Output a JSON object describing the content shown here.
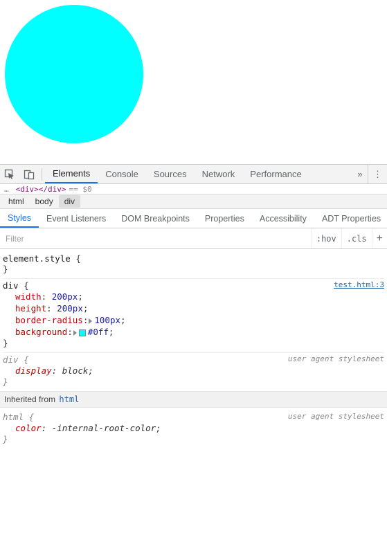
{
  "preview": {
    "shape_color": "#00ffff"
  },
  "toolbar_icons": {
    "select": "select-element-icon",
    "device": "toggle-device-icon",
    "more": "»",
    "kebab": "⋮"
  },
  "main_tabs": [
    {
      "label": "Elements",
      "active": true
    },
    {
      "label": "Console",
      "active": false
    },
    {
      "label": "Sources",
      "active": false
    },
    {
      "label": "Network",
      "active": false
    },
    {
      "label": "Performance",
      "active": false
    }
  ],
  "dom_strip": {
    "ellipsis": "…",
    "text1": "<div>",
    "text2": "</div>",
    "suffix": " == $0"
  },
  "breadcrumbs": [
    {
      "label": "html",
      "selected": false
    },
    {
      "label": "body",
      "selected": false
    },
    {
      "label": "div",
      "selected": true
    }
  ],
  "sub_tabs": [
    {
      "label": "Styles",
      "active": true
    },
    {
      "label": "Event Listeners",
      "active": false
    },
    {
      "label": "DOM Breakpoints",
      "active": false
    },
    {
      "label": "Properties",
      "active": false
    },
    {
      "label": "Accessibility",
      "active": false
    },
    {
      "label": "ADT Properties",
      "active": false
    }
  ],
  "filter": {
    "placeholder": "Filter",
    "hov": ":hov",
    "cls": ".cls",
    "plus": "+"
  },
  "rules": {
    "element_style": {
      "selector": "element.style",
      "open": "{",
      "close": "}"
    },
    "div_main": {
      "selector": "div",
      "open": "{",
      "close": "}",
      "origin_file": "test.html:3",
      "decls": [
        {
          "name": "width",
          "value": "200px",
          "expand": false,
          "swatch": null
        },
        {
          "name": "height",
          "value": "200px",
          "expand": false,
          "swatch": null
        },
        {
          "name": "border-radius",
          "value": "100px",
          "expand": true,
          "swatch": null
        },
        {
          "name": "background",
          "value": "#0ff",
          "expand": true,
          "swatch": "#00ffff"
        }
      ]
    },
    "div_ua": {
      "selector": "div",
      "open": "{",
      "close": "}",
      "origin": "user agent stylesheet",
      "decls": [
        {
          "name": "display",
          "value": "block"
        }
      ]
    },
    "inherited_label": "Inherited from",
    "inherited_from": "html",
    "html_ua": {
      "selector": "html",
      "open": "{",
      "close": "}",
      "origin": "user agent stylesheet",
      "decls": [
        {
          "name": "color",
          "value": "-internal-root-color"
        }
      ]
    }
  }
}
